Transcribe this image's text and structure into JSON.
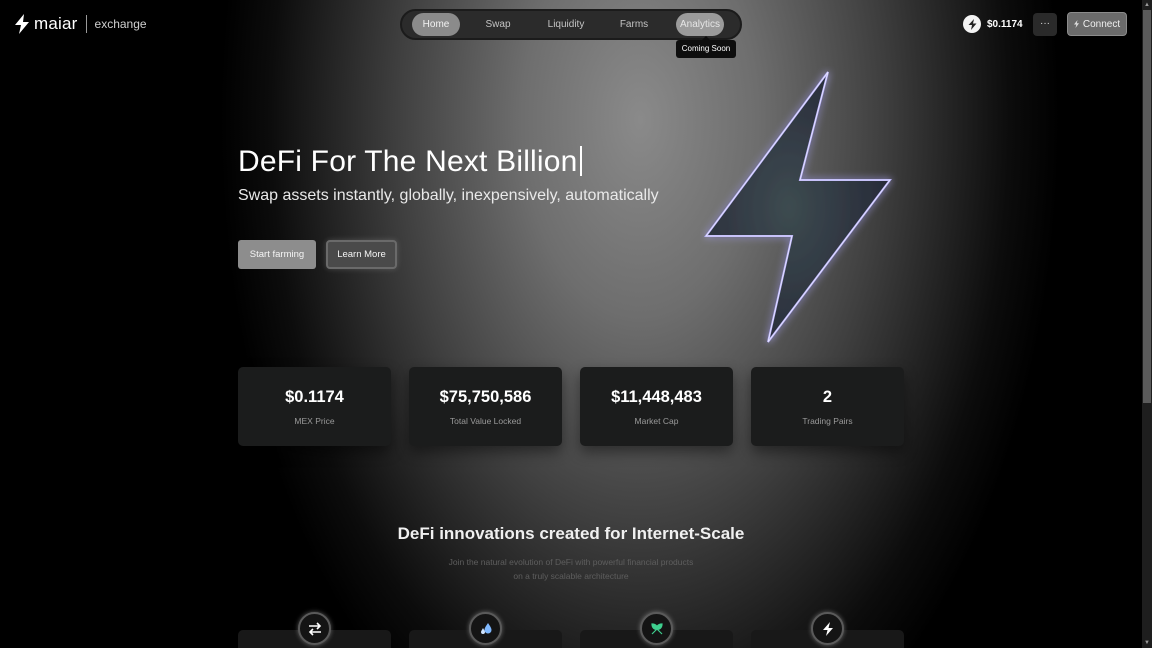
{
  "header": {
    "logo_word": "maiar",
    "logo_sub": "exchange",
    "nav": [
      {
        "label": "Home",
        "active": true
      },
      {
        "label": "Swap"
      },
      {
        "label": "Liquidity"
      },
      {
        "label": "Farms"
      },
      {
        "label": "Analytics",
        "hovered": true
      }
    ],
    "tooltip": "Coming Soon",
    "price": "$0.1174",
    "more_label": "···",
    "connect_label": "Connect"
  },
  "hero": {
    "title": "DeFi For The Next Billion",
    "subtitle": "Swap assets instantly, globally, inexpensively, automatically",
    "primary_button": "Start farming",
    "secondary_button": "Learn More"
  },
  "stats": [
    {
      "value": "$0.1174",
      "label": "MEX Price"
    },
    {
      "value": "$75,750,586",
      "label": "Total Value Locked"
    },
    {
      "value": "$11,448,483",
      "label": "Market Cap"
    },
    {
      "value": "2",
      "label": "Trading Pairs"
    }
  ],
  "innovations": {
    "title": "DeFi innovations created for Internet-Scale",
    "subtitle_line1": "Join the natural evolution of DeFi with powerful financial products",
    "subtitle_line2": "on a truly scalable architecture",
    "icons": [
      "swap-arrows-icon",
      "liquidity-drops-icon",
      "farm-leaf-icon",
      "bolt-icon"
    ]
  },
  "colors": {
    "accent_glow": "#8a7bff",
    "farm_green": "#3ecf8e",
    "drop_blue": "#7fb8ff"
  }
}
